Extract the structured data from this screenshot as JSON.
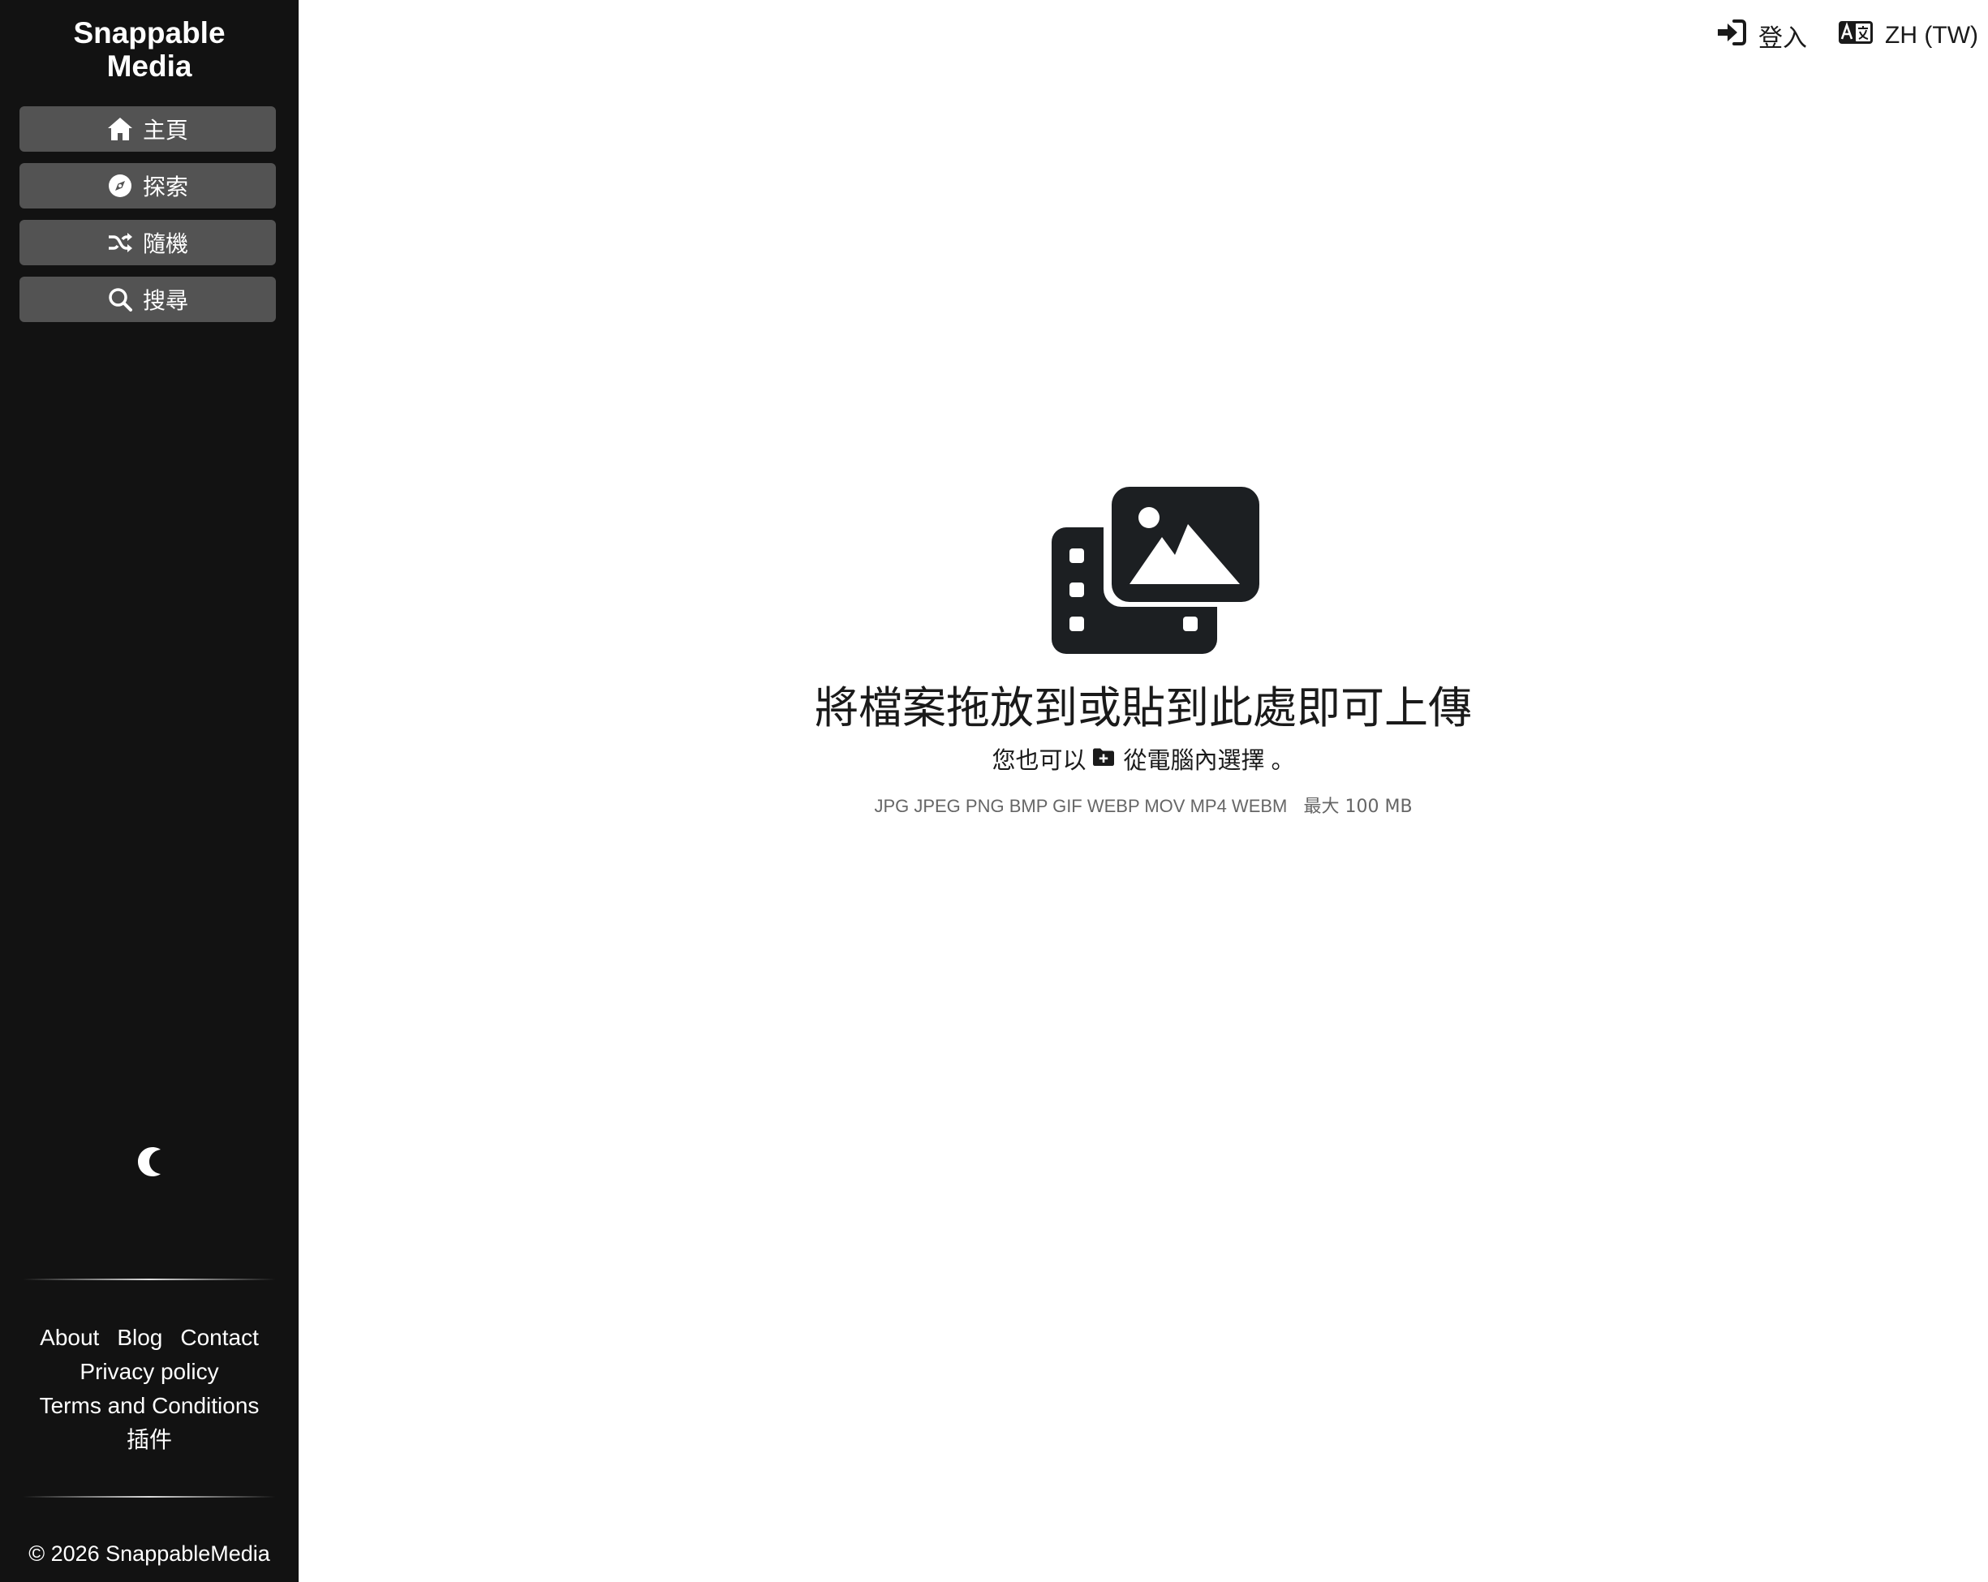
{
  "sidebar": {
    "brand": "Snappable Media",
    "nav": [
      {
        "label": "主頁",
        "icon": "home-icon"
      },
      {
        "label": "探索",
        "icon": "compass-icon"
      },
      {
        "label": "隨機",
        "icon": "shuffle-icon"
      },
      {
        "label": "搜尋",
        "icon": "search-icon"
      }
    ],
    "theme_icon": "moon-icon",
    "footer": {
      "about": "About",
      "blog": "Blog",
      "contact": "Contact",
      "privacy": "Privacy policy",
      "terms": "Terms and Conditions",
      "plugins": "插件"
    },
    "copyright": "© 2026 SnappableMedia"
  },
  "topbar": {
    "login": "登入",
    "language": "ZH (TW)"
  },
  "upload": {
    "title": "將檔案拖放到或貼到此處即可上傳",
    "subtitle_prefix": "您也可以",
    "subtitle_link": "從電腦內選擇",
    "subtitle_suffix": "。",
    "formats": "JPG JPEG PNG BMP GIF WEBP MOV MP4 WEBM",
    "max_size": "最大 100 MB"
  },
  "colors": {
    "sidebar_bg": "#121212",
    "nav_button_bg": "#535353",
    "icon_dark": "#1c1f22",
    "muted_text": "#666666"
  }
}
